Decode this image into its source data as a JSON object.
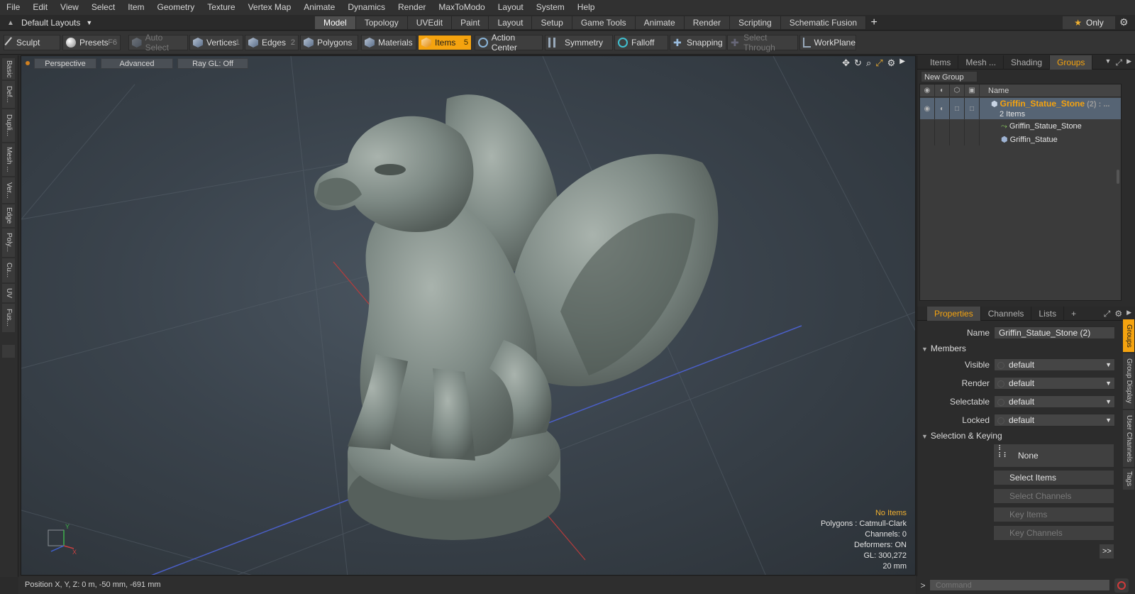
{
  "menu": [
    "File",
    "Edit",
    "View",
    "Select",
    "Item",
    "Geometry",
    "Texture",
    "Vertex Map",
    "Animate",
    "Dynamics",
    "Render",
    "MaxToModo",
    "Layout",
    "System",
    "Help"
  ],
  "layout_selector": "Default Layouts",
  "mode_tabs": [
    {
      "label": "Model",
      "active": true
    },
    {
      "label": "Topology"
    },
    {
      "label": "UVEdit"
    },
    {
      "label": "Paint"
    },
    {
      "label": "Layout"
    },
    {
      "label": "Setup"
    },
    {
      "label": "Game Tools"
    },
    {
      "label": "Animate"
    },
    {
      "label": "Render"
    },
    {
      "label": "Scripting"
    },
    {
      "label": "Schematic Fusion"
    }
  ],
  "only_label": "Only",
  "toolbar": {
    "sculpt": "Sculpt",
    "presets": "Presets",
    "presets_key": "F6",
    "auto_select": "Auto Select",
    "vertices": "Vertices",
    "vertices_key": "1",
    "edges": "Edges",
    "edges_key": "2",
    "polygons": "Polygons",
    "materials": "Materials",
    "items": "Items",
    "items_key": "5",
    "action_center": "Action Center",
    "symmetry": "Symmetry",
    "falloff": "Falloff",
    "snapping": "Snapping",
    "select_through": "Select Through",
    "workplane": "WorkPlane"
  },
  "left_tabs": [
    "Basic",
    "Def...",
    "Dupli...",
    "Mesh ...",
    "Ver...",
    "Edge",
    "Poly...",
    "Cu...",
    "UV",
    "Fus..."
  ],
  "viewport": {
    "view_mode": "Perspective",
    "advanced": "Advanced",
    "raygl": "Ray GL: Off",
    "info": {
      "no_items": "No Items",
      "polygons": "Polygons : Catmull-Clark",
      "channels": "Channels: 0",
      "deformers": "Deformers: ON",
      "gl": "GL: 300,272",
      "scale": "20 mm"
    }
  },
  "status": {
    "position": "Position X, Y, Z:  0 m, -50 mm, -691 mm"
  },
  "top_panel": {
    "tabs": [
      {
        "label": "Items"
      },
      {
        "label": "Mesh ..."
      },
      {
        "label": "Shading"
      },
      {
        "label": "Groups",
        "active": true
      }
    ],
    "new_group": "New Group",
    "name_header": "Name",
    "group": {
      "name": "Griffin_Statue_Stone",
      "count": "(2) : ...",
      "items_label": "2 Items",
      "children": [
        "Griffin_Statue_Stone",
        "Griffin_Statue"
      ]
    }
  },
  "properties": {
    "tabs": [
      {
        "label": "Properties",
        "active": true
      },
      {
        "label": "Channels"
      },
      {
        "label": "Lists"
      }
    ],
    "name_label": "Name",
    "name_value": "Griffin_Statue_Stone (2)",
    "members_section": "Members",
    "fields": [
      {
        "label": "Visible",
        "value": "default"
      },
      {
        "label": "Render",
        "value": "default"
      },
      {
        "label": "Selectable",
        "value": "default"
      },
      {
        "label": "Locked",
        "value": "default"
      }
    ],
    "selection_section": "Selection & Keying",
    "none_label": "None",
    "buttons": [
      {
        "label": "Select Items",
        "enabled": true
      },
      {
        "label": "Select Channels",
        "enabled": false
      },
      {
        "label": "Key Items",
        "enabled": false
      },
      {
        "label": "Key Channels",
        "enabled": false
      }
    ],
    "more": ">>",
    "side_tabs": [
      {
        "label": "Groups",
        "active": true
      },
      {
        "label": "Group Display"
      },
      {
        "label": "User Channels"
      },
      {
        "label": "Tags"
      }
    ]
  },
  "command": {
    "placeholder": "Command"
  },
  "colors": {
    "accent": "#f5a30f",
    "selection": "#566474"
  }
}
